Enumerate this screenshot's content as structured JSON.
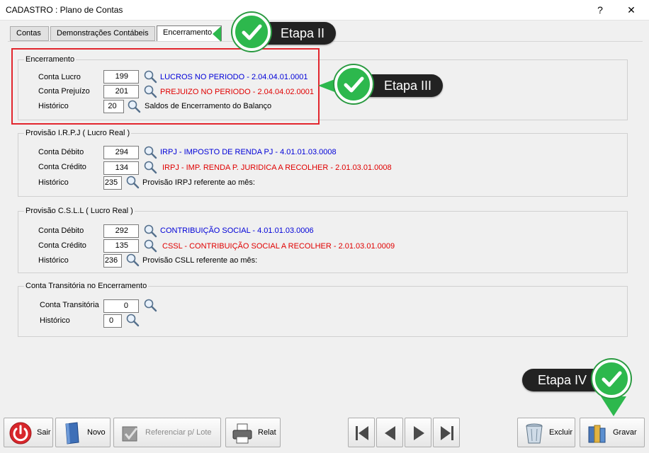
{
  "window": {
    "title": "CADASTRO : Plano de Contas",
    "help_glyph": "?",
    "close_glyph": "✕"
  },
  "tabs": [
    {
      "label": "Contas"
    },
    {
      "label": "Demonstrações Contábeis"
    },
    {
      "label": "Encerramento"
    }
  ],
  "encerramento": {
    "legend": "Encerramento",
    "rows": [
      {
        "label": "Conta Lucro",
        "value": "199",
        "desc": "LUCROS NO PERIODO - 2.04.04.01.0001",
        "color": "#0000d8"
      },
      {
        "label": "Conta Prejuízo",
        "value": "201",
        "desc": "PREJUIZO NO PERIODO - 2.04.04.02.0001",
        "color": "#e00000"
      },
      {
        "label": "Histórico",
        "value": "20",
        "desc": "Saldos de Encerramento do Balanço",
        "color": "#000000"
      }
    ]
  },
  "irpj": {
    "legend": "Provisão I.R.P.J ( Lucro Real )",
    "rows": [
      {
        "label": "Conta Débito",
        "value": "294",
        "desc": "IRPJ - IMPOSTO DE RENDA PJ - 4.01.01.03.0008",
        "color": "#0000d8"
      },
      {
        "label": "Conta Crédito",
        "value": "134",
        "desc": "IRPJ - IMP. RENDA P. JURIDICA A RECOLHER - 2.01.03.01.0008",
        "color": "#e00000"
      },
      {
        "label": "Histórico",
        "value": "235",
        "desc": "Provisão IRPJ referente ao mês:",
        "color": "#000000"
      }
    ]
  },
  "csll": {
    "legend": "Provisão C.S.L.L ( Lucro Real )",
    "rows": [
      {
        "label": "Conta Débito",
        "value": "292",
        "desc": "CONTRIBUIÇÃO SOCIAL - 4.01.01.03.0006",
        "color": "#0000d8"
      },
      {
        "label": "Conta Crédito",
        "value": "135",
        "desc": "CSSL - CONTRIBUIÇÃO SOCIAL A RECOLHER - 2.01.03.01.0009",
        "color": "#e00000"
      },
      {
        "label": "Histórico",
        "value": "236",
        "desc": "Provisão CSLL referente ao mês:",
        "color": "#000000"
      }
    ]
  },
  "transitoria": {
    "legend": "Conta Transitória no Encerramento",
    "rows": [
      {
        "label": "Conta Transitória",
        "value": "0"
      },
      {
        "label": "Histórico",
        "value": "0"
      }
    ]
  },
  "annotations": {
    "etapa2": "Etapa II",
    "etapa3": "Etapa III",
    "etapa4": "Etapa IV",
    "accent_red": "#e2262e",
    "check_green": "#2db84d"
  },
  "toolbar": {
    "sair": "Sair",
    "novo": "Novo",
    "referenciar": "Referenciar p/ Lote",
    "relat": "Relat",
    "excluir": "Excluir",
    "gravar": "Gravar"
  }
}
